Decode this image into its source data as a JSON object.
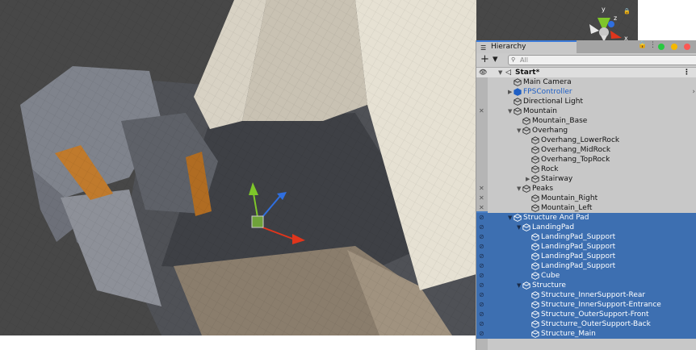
{
  "scene_view": {
    "gizmo": {
      "y_label": "y",
      "z_label": "z",
      "x_label": "x",
      "y_color": "#7ec62a",
      "z_color": "#2f6fe0",
      "x_color": "#e0351c"
    }
  },
  "hierarchy": {
    "tab_label": "Hierarchy",
    "add_label": "+ ▾",
    "search_placeholder": "All",
    "window_buttons": {
      "green": "#28c940",
      "yellow": "#f5b800",
      "red": "#fc5753"
    },
    "scene_name": "Start*",
    "items": [
      {
        "label": "Main Camera",
        "depth": 0,
        "arrow": "",
        "selected": false,
        "vis": ""
      },
      {
        "label": "FPSController",
        "depth": 0,
        "arrow": "▶",
        "selected": false,
        "vis": "",
        "prefab": true
      },
      {
        "label": "Directional Light",
        "depth": 0,
        "arrow": "",
        "selected": false,
        "vis": ""
      },
      {
        "label": "Mountain",
        "depth": 0,
        "arrow": "▼",
        "selected": false,
        "vis": "pick-off"
      },
      {
        "label": "Mountain_Base",
        "depth": 1,
        "arrow": "",
        "selected": false,
        "vis": ""
      },
      {
        "label": "Overhang",
        "depth": 1,
        "arrow": "▼",
        "selected": false,
        "vis": ""
      },
      {
        "label": "Overhang_LowerRock",
        "depth": 2,
        "arrow": "",
        "selected": false,
        "vis": ""
      },
      {
        "label": "Overhang_MidRock",
        "depth": 2,
        "arrow": "",
        "selected": false,
        "vis": ""
      },
      {
        "label": "Overhang_TopRock",
        "depth": 2,
        "arrow": "",
        "selected": false,
        "vis": ""
      },
      {
        "label": "Rock",
        "depth": 2,
        "arrow": "",
        "selected": false,
        "vis": ""
      },
      {
        "label": "Stairway",
        "depth": 2,
        "arrow": "▶",
        "selected": false,
        "vis": ""
      },
      {
        "label": "Peaks",
        "depth": 1,
        "arrow": "▼",
        "selected": false,
        "vis": "pick-off"
      },
      {
        "label": "Mountain_Right",
        "depth": 2,
        "arrow": "",
        "selected": false,
        "vis": "pick-off"
      },
      {
        "label": "Mountain_Left",
        "depth": 2,
        "arrow": "",
        "selected": false,
        "vis": "pick-off"
      },
      {
        "label": "Structure And Pad",
        "depth": 0,
        "arrow": "▼",
        "selected": true,
        "vis": "hidden"
      },
      {
        "label": "LandingPad",
        "depth": 1,
        "arrow": "▼",
        "selected": true,
        "vis": "hidden"
      },
      {
        "label": "LandingPad_Support",
        "depth": 2,
        "arrow": "",
        "selected": true,
        "vis": "hidden"
      },
      {
        "label": "LandingPad_Support",
        "depth": 2,
        "arrow": "",
        "selected": true,
        "vis": "hidden"
      },
      {
        "label": "LandingPad_Support",
        "depth": 2,
        "arrow": "",
        "selected": true,
        "vis": "hidden"
      },
      {
        "label": "LandingPad_Support",
        "depth": 2,
        "arrow": "",
        "selected": true,
        "vis": "hidden"
      },
      {
        "label": "Cube",
        "depth": 2,
        "arrow": "",
        "selected": true,
        "vis": "hidden"
      },
      {
        "label": "Structure",
        "depth": 1,
        "arrow": "▼",
        "selected": true,
        "vis": "hidden"
      },
      {
        "label": "Structure_InnerSupport-Rear",
        "depth": 2,
        "arrow": "",
        "selected": true,
        "vis": "hidden"
      },
      {
        "label": "Structure_InnerSupport-Entrance",
        "depth": 2,
        "arrow": "",
        "selected": true,
        "vis": "hidden"
      },
      {
        "label": "Structure_OuterSupport-Front",
        "depth": 2,
        "arrow": "",
        "selected": true,
        "vis": "hidden"
      },
      {
        "label": "Structurre_OuterSupport-Back",
        "depth": 2,
        "arrow": "",
        "selected": true,
        "vis": "hidden"
      },
      {
        "label": "Structure_Main",
        "depth": 2,
        "arrow": "",
        "selected": true,
        "vis": "hidden"
      }
    ],
    "selection_color": "#3d6fb1",
    "prefab_color": "#1f5fc4"
  }
}
